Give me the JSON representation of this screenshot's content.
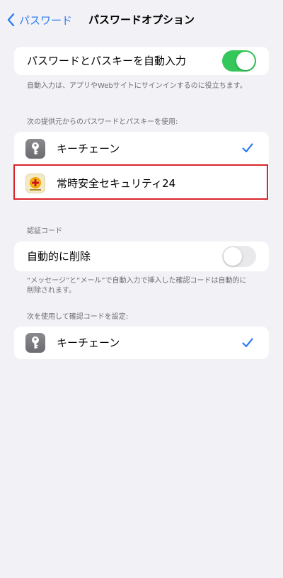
{
  "nav": {
    "back_label": "パスワード",
    "title": "パスワードオプション"
  },
  "autofill": {
    "label": "パスワードとパスキーを自動入力",
    "enabled": true,
    "note": "自動入力は、アプリやWebサイトにサインインするのに役立ちます。"
  },
  "providers": {
    "header": "次の提供元からのパスワードとパスキーを使用:",
    "items": [
      {
        "label": "キーチェーン",
        "icon": "keychain-icon",
        "checked": true
      },
      {
        "label": "常時安全セキュリティ24",
        "icon": "security-app-icon",
        "checked": false
      }
    ]
  },
  "codes": {
    "header": "認証コード",
    "delete_label": "自動的に削除",
    "delete_enabled": false,
    "note": "“メッセージ”と“メール”で自動入力で挿入した確認コードは自動的に削除されます。"
  },
  "code_setup": {
    "header": "次を使用して確認コードを設定:",
    "items": [
      {
        "label": "キーチェーン",
        "icon": "keychain-icon",
        "checked": true
      }
    ]
  },
  "colors": {
    "accent": "#2f7cf6",
    "toggle_on": "#34c759",
    "toggle_off": "#e9e9eb",
    "highlight": "#d8242a",
    "background": "#f2f1f6"
  }
}
